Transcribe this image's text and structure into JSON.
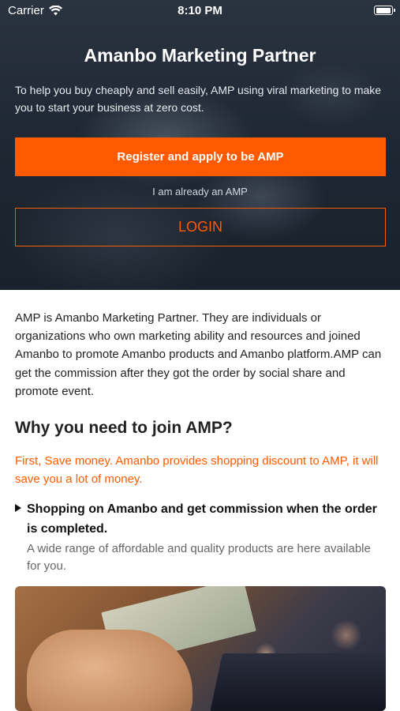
{
  "status_bar": {
    "carrier": "Carrier",
    "time": "8:10 PM",
    "battery_level": 1.0
  },
  "hero": {
    "title": "Amanbo Marketing Partner",
    "description": "To help you buy cheaply and sell easily, AMP using viral marketing to make you to start your business at zero cost.",
    "register_label": "Register and apply to be AMP",
    "already_text": "I am already an AMP",
    "login_label": "LOGIN"
  },
  "content": {
    "intro": "AMP is Amanbo Marketing Partner. They are individuals or  organizations who own marketing ability and resources and joined Amanbo to promote Amanbo products and Amanbo platform.AMP can get the commission after they got the order by social share and promote event.",
    "section_heading": "Why you need to join AMP?",
    "benefit_text": "First, Save money. Amanbo provides shopping discount to AMP, it will save you a lot of money.",
    "bullet_title": "Shopping on Amanbo and get commission when the order is completed.",
    "bullet_desc": "A wide range of affordable and quality products are here available for you."
  },
  "colors": {
    "accent": "#ff5a00",
    "hero_bg": "#1e2733",
    "text": "#222222",
    "muted": "#666666"
  },
  "icons": {
    "wifi": "wifi-icon",
    "battery": "battery-icon",
    "bullet": "triangle-right-icon"
  }
}
